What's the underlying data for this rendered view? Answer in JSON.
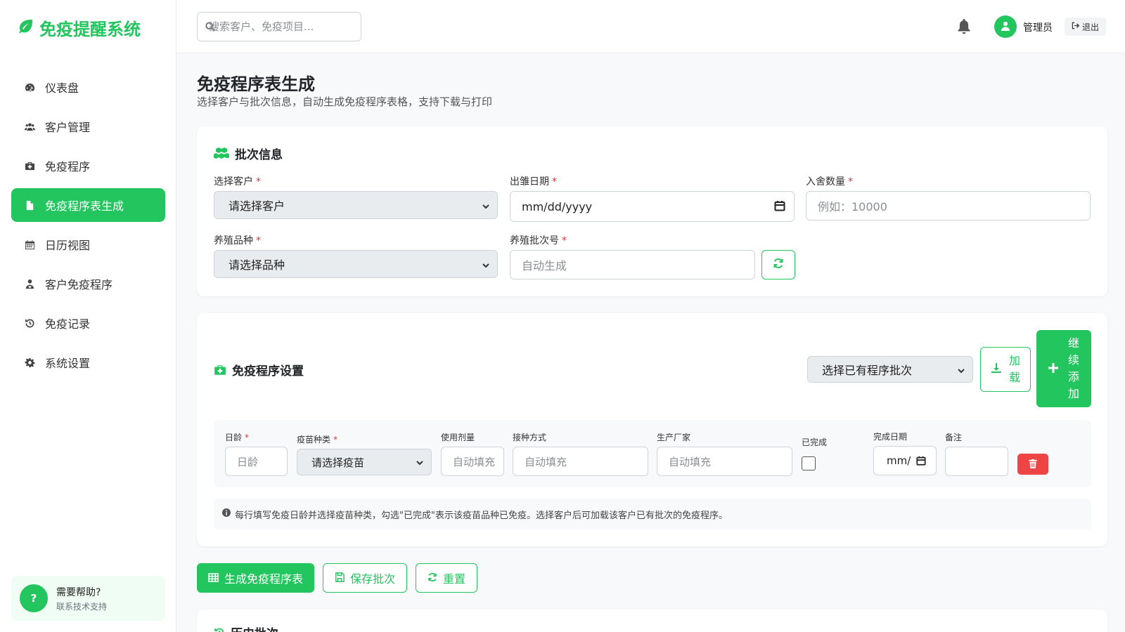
{
  "brand": {
    "title": "免疫提醒系统",
    "color": "#22c55e"
  },
  "sidebar": {
    "items": [
      {
        "label": "仪表盘",
        "icon": "gauge-icon",
        "active": false
      },
      {
        "label": "客户管理",
        "icon": "users-icon",
        "active": false
      },
      {
        "label": "免疫程序",
        "icon": "medkit-icon",
        "active": false
      },
      {
        "label": "免疫程序表生成",
        "icon": "file-icon",
        "active": true
      },
      {
        "label": "日历视图",
        "icon": "calendar-icon",
        "active": false
      },
      {
        "label": "客户免疫程序",
        "icon": "user-doctor-icon",
        "active": false
      },
      {
        "label": "免疫记录",
        "icon": "history-icon",
        "active": false
      },
      {
        "label": "系统设置",
        "icon": "gear-icon",
        "active": false
      }
    ],
    "help": {
      "badge": "?",
      "title": "需要帮助?",
      "subtitle": "联系技术支持"
    }
  },
  "header": {
    "search_placeholder": "搜索客户、免疫项目...",
    "username": "管理员",
    "logout_label": "退出"
  },
  "page": {
    "title": "免疫程序表生成",
    "subtitle": "选择客户与批次信息，自动生成免疫程序表格，支持下载与打印"
  },
  "batch_info": {
    "title": "批次信息",
    "customer_label": "选择客户",
    "customer_value": "请选择客户",
    "hatch_date_label": "出雏日期",
    "hatch_date_value": "mm/dd/yyyy",
    "count_label": "入舍数量",
    "count_placeholder": "例如：10000",
    "breed_label": "养殖品种",
    "breed_value": "请选择品种",
    "batch_no_label": "养殖批次号",
    "batch_no_placeholder": "自动生成",
    "required_mark": "*"
  },
  "program": {
    "title": "免疫程序设置",
    "existing_batch_value": "选择已有程序批次",
    "load_label_1": "加",
    "load_label_2": "载",
    "add_label_1": "继",
    "add_label_2": "续",
    "add_label_3": "添",
    "add_label_4": "加",
    "row": {
      "age_label": "日龄",
      "age_placeholder": "日龄",
      "vaccine_label": "疫苗种类",
      "vaccine_value": "请选择疫苗",
      "dose_label": "使用剂量",
      "dose_placeholder": "自动填充",
      "method_label": "接种方式",
      "method_placeholder": "自动填充",
      "maker_label": "生产厂家",
      "maker_placeholder": "自动填充",
      "done_label": "已完成",
      "date_label": "完成日期",
      "date_value": "mm/",
      "note_label": "备注"
    },
    "hint": "每行填写免疫日龄并选择疫苗种类，勾选\"已完成\"表示该疫苗品种已免疫。选择客户后可加载该客户已有批次的免疫程序。"
  },
  "actions": {
    "generate": "生成免疫程序表",
    "save": "保存批次",
    "reset": "重置"
  },
  "history": {
    "title": "历史批次"
  },
  "colors": {
    "primary": "#22c55e",
    "danger": "#ef4444",
    "required": "#dc3545"
  }
}
